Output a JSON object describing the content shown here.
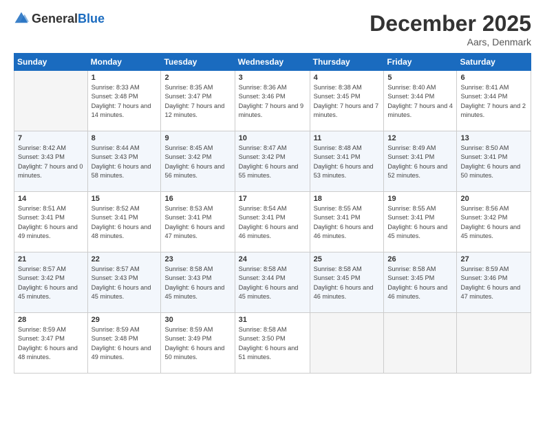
{
  "header": {
    "logo_general": "General",
    "logo_blue": "Blue",
    "title": "December 2025",
    "location": "Aars, Denmark"
  },
  "weekdays": [
    "Sunday",
    "Monday",
    "Tuesday",
    "Wednesday",
    "Thursday",
    "Friday",
    "Saturday"
  ],
  "weeks": [
    [
      {
        "day": "",
        "empty": true
      },
      {
        "day": "1",
        "sunrise": "8:33 AM",
        "sunset": "3:48 PM",
        "daylight": "7 hours and 14 minutes."
      },
      {
        "day": "2",
        "sunrise": "8:35 AM",
        "sunset": "3:47 PM",
        "daylight": "7 hours and 12 minutes."
      },
      {
        "day": "3",
        "sunrise": "8:36 AM",
        "sunset": "3:46 PM",
        "daylight": "7 hours and 9 minutes."
      },
      {
        "day": "4",
        "sunrise": "8:38 AM",
        "sunset": "3:45 PM",
        "daylight": "7 hours and 7 minutes."
      },
      {
        "day": "5",
        "sunrise": "8:40 AM",
        "sunset": "3:44 PM",
        "daylight": "7 hours and 4 minutes."
      },
      {
        "day": "6",
        "sunrise": "8:41 AM",
        "sunset": "3:44 PM",
        "daylight": "7 hours and 2 minutes."
      }
    ],
    [
      {
        "day": "7",
        "sunrise": "8:42 AM",
        "sunset": "3:43 PM",
        "daylight": "7 hours and 0 minutes."
      },
      {
        "day": "8",
        "sunrise": "8:44 AM",
        "sunset": "3:43 PM",
        "daylight": "6 hours and 58 minutes."
      },
      {
        "day": "9",
        "sunrise": "8:45 AM",
        "sunset": "3:42 PM",
        "daylight": "6 hours and 56 minutes."
      },
      {
        "day": "10",
        "sunrise": "8:47 AM",
        "sunset": "3:42 PM",
        "daylight": "6 hours and 55 minutes."
      },
      {
        "day": "11",
        "sunrise": "8:48 AM",
        "sunset": "3:41 PM",
        "daylight": "6 hours and 53 minutes."
      },
      {
        "day": "12",
        "sunrise": "8:49 AM",
        "sunset": "3:41 PM",
        "daylight": "6 hours and 52 minutes."
      },
      {
        "day": "13",
        "sunrise": "8:50 AM",
        "sunset": "3:41 PM",
        "daylight": "6 hours and 50 minutes."
      }
    ],
    [
      {
        "day": "14",
        "sunrise": "8:51 AM",
        "sunset": "3:41 PM",
        "daylight": "6 hours and 49 minutes."
      },
      {
        "day": "15",
        "sunrise": "8:52 AM",
        "sunset": "3:41 PM",
        "daylight": "6 hours and 48 minutes."
      },
      {
        "day": "16",
        "sunrise": "8:53 AM",
        "sunset": "3:41 PM",
        "daylight": "6 hours and 47 minutes."
      },
      {
        "day": "17",
        "sunrise": "8:54 AM",
        "sunset": "3:41 PM",
        "daylight": "6 hours and 46 minutes."
      },
      {
        "day": "18",
        "sunrise": "8:55 AM",
        "sunset": "3:41 PM",
        "daylight": "6 hours and 46 minutes."
      },
      {
        "day": "19",
        "sunrise": "8:55 AM",
        "sunset": "3:41 PM",
        "daylight": "6 hours and 45 minutes."
      },
      {
        "day": "20",
        "sunrise": "8:56 AM",
        "sunset": "3:42 PM",
        "daylight": "6 hours and 45 minutes."
      }
    ],
    [
      {
        "day": "21",
        "sunrise": "8:57 AM",
        "sunset": "3:42 PM",
        "daylight": "6 hours and 45 minutes."
      },
      {
        "day": "22",
        "sunrise": "8:57 AM",
        "sunset": "3:43 PM",
        "daylight": "6 hours and 45 minutes."
      },
      {
        "day": "23",
        "sunrise": "8:58 AM",
        "sunset": "3:43 PM",
        "daylight": "6 hours and 45 minutes."
      },
      {
        "day": "24",
        "sunrise": "8:58 AM",
        "sunset": "3:44 PM",
        "daylight": "6 hours and 45 minutes."
      },
      {
        "day": "25",
        "sunrise": "8:58 AM",
        "sunset": "3:45 PM",
        "daylight": "6 hours and 46 minutes."
      },
      {
        "day": "26",
        "sunrise": "8:58 AM",
        "sunset": "3:45 PM",
        "daylight": "6 hours and 46 minutes."
      },
      {
        "day": "27",
        "sunrise": "8:59 AM",
        "sunset": "3:46 PM",
        "daylight": "6 hours and 47 minutes."
      }
    ],
    [
      {
        "day": "28",
        "sunrise": "8:59 AM",
        "sunset": "3:47 PM",
        "daylight": "6 hours and 48 minutes."
      },
      {
        "day": "29",
        "sunrise": "8:59 AM",
        "sunset": "3:48 PM",
        "daylight": "6 hours and 49 minutes."
      },
      {
        "day": "30",
        "sunrise": "8:59 AM",
        "sunset": "3:49 PM",
        "daylight": "6 hours and 50 minutes."
      },
      {
        "day": "31",
        "sunrise": "8:58 AM",
        "sunset": "3:50 PM",
        "daylight": "6 hours and 51 minutes."
      },
      {
        "day": "",
        "empty": true
      },
      {
        "day": "",
        "empty": true
      },
      {
        "day": "",
        "empty": true
      }
    ]
  ]
}
